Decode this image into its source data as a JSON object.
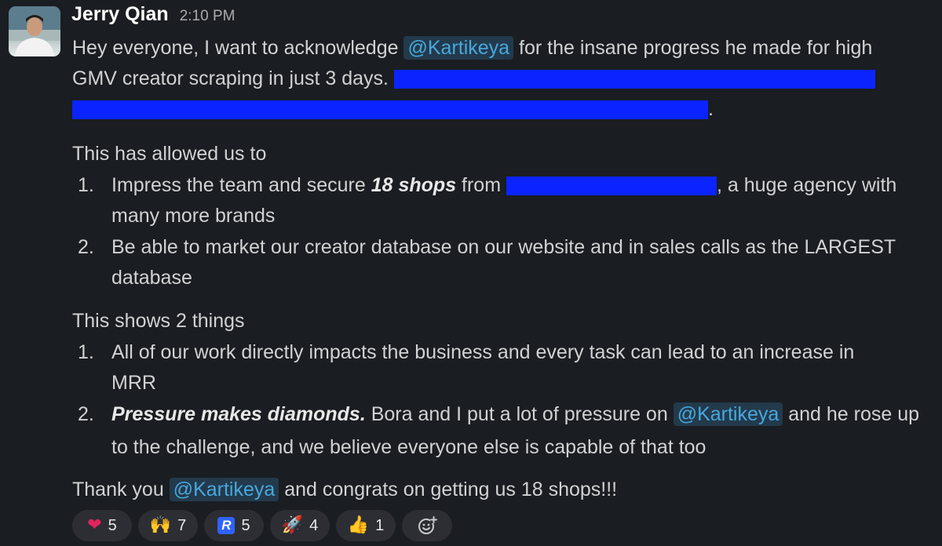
{
  "message": {
    "author": "Jerry Qian",
    "timestamp": "2:10 PM",
    "mention": "@Kartikeya",
    "p1_a": "Hey everyone, I want to acknowledge ",
    "p1_b": " for the insane progress he made for high",
    "p1_c": "GMV creator scraping in just 3 days. ",
    "p1_d": ".",
    "p2_intro": "This has allowed us to",
    "list1": [
      {
        "num": "1.",
        "a": "Impress the team and secure ",
        "bold": "18 shops",
        "b": " from ",
        "c": ", a huge agency with",
        "cont": "many more brands"
      },
      {
        "num": "2.",
        "a": "Be able to market our creator database on our website and in sales calls as the LARGEST",
        "cont": "database"
      }
    ],
    "p3_intro": "This shows 2 things",
    "list2": [
      {
        "num": "1.",
        "a": "All of our work directly impacts the business and every task can lead to an increase in",
        "cont": "MRR"
      },
      {
        "num": "2.",
        "bold": "Pressure makes diamonds.",
        "a": " Bora and I put a lot of pressure on ",
        "b": " and he rose up",
        "cont": "to the challenge, and we believe everyone else is capable of that too"
      }
    ],
    "p4_a": "Thank you ",
    "p4_b": " and congrats on getting us 18 shops!!!"
  },
  "reactions": [
    {
      "emoji": "heart-icon",
      "glyph": "❤",
      "count": "5"
    },
    {
      "emoji": "raised-hands-icon",
      "glyph": "🙌",
      "count": "7"
    },
    {
      "emoji": "r-logo-icon",
      "glyph": "R",
      "count": "5"
    },
    {
      "emoji": "rocket-icon",
      "glyph": "🚀",
      "count": "4"
    },
    {
      "emoji": "thumbs-up-icon",
      "glyph": "👍",
      "count": "1"
    }
  ],
  "colors": {
    "background": "#1a1d21",
    "mention_text": "#47a8dd",
    "mention_bg": "#233a4c",
    "redaction": "#0b24ff"
  }
}
